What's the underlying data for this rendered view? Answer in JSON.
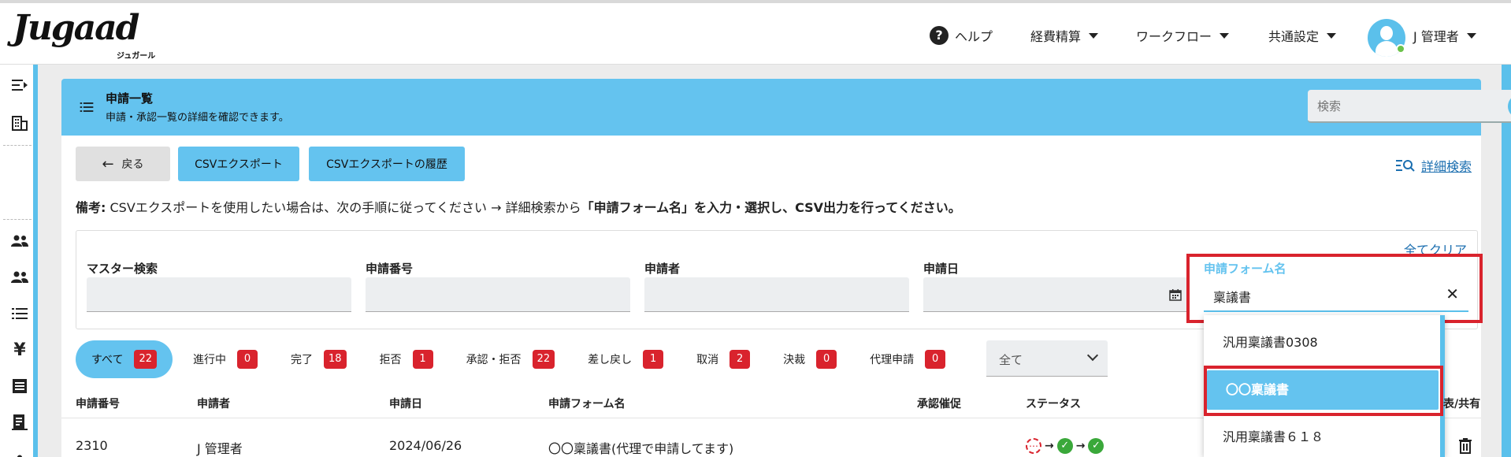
{
  "header": {
    "logo_text": "Jugaad",
    "logo_sub": "ジュガール",
    "help_label": "ヘルプ",
    "nav": [
      "経費精算",
      "ワークフロー",
      "共通設定"
    ],
    "user_name": "J 管理者"
  },
  "sidebar": {
    "icons": [
      "expand-menu-icon",
      "building-icon",
      "users-icon",
      "group-icon",
      "list-icon",
      "yen-icon",
      "document-icon",
      "receipt-icon"
    ]
  },
  "panel": {
    "title": "申請一覧",
    "subtitle": "申請・承認一覧の詳細を確認できます。",
    "search_placeholder": "検索"
  },
  "actions": {
    "back": "戻る",
    "csv_export": "CSVエクスポート",
    "csv_history": "CSVエクスポートの履歴",
    "advanced_search": "詳細検索"
  },
  "note": {
    "label": "備考:",
    "text": "CSVエクスポートを使用したい場合は、次の手順に従ってください → 詳細検索から",
    "emphasis": "「申請フォーム名」を入力・選択し、CSV出力を行ってください。"
  },
  "filters": {
    "clear_all": "全てクリア",
    "master_search": "マスター検索",
    "request_number": "申請番号",
    "applicant": "申請者",
    "request_date": "申請日",
    "form_name_label": "申請フォーム名",
    "form_name_value": "稟議書"
  },
  "tabs": [
    {
      "label": "すべて",
      "count": "22"
    },
    {
      "label": "進行中",
      "count": "0"
    },
    {
      "label": "完了",
      "count": "18"
    },
    {
      "label": "拒否",
      "count": "1"
    },
    {
      "label": "承認・拒否",
      "count": "22"
    },
    {
      "label": "差し戻し",
      "count": "1"
    },
    {
      "label": "取消",
      "count": "2"
    },
    {
      "label": "決裁",
      "count": "0"
    },
    {
      "label": "代理申請",
      "count": "0"
    }
  ],
  "select_filter": "全て",
  "table": {
    "headers": [
      "申請番号",
      "申請者",
      "申請日",
      "申請フォーム名",
      "承認催促",
      "ステータス",
      "表/共有"
    ],
    "rows": [
      {
        "number": "2310",
        "applicant": "J 管理者",
        "date": "2024/06/26",
        "form": "〇〇稟議書(代理で申請してます)"
      }
    ]
  },
  "dropdown": {
    "options": [
      "汎用稟議書0308",
      "〇〇稟議書",
      "汎用稟議書６１８"
    ],
    "selected_index": 1
  },
  "colors": {
    "accent": "#64c3ef",
    "badge": "#d9232d",
    "link": "#1c6fb0",
    "highlight_border": "#d9232d"
  }
}
